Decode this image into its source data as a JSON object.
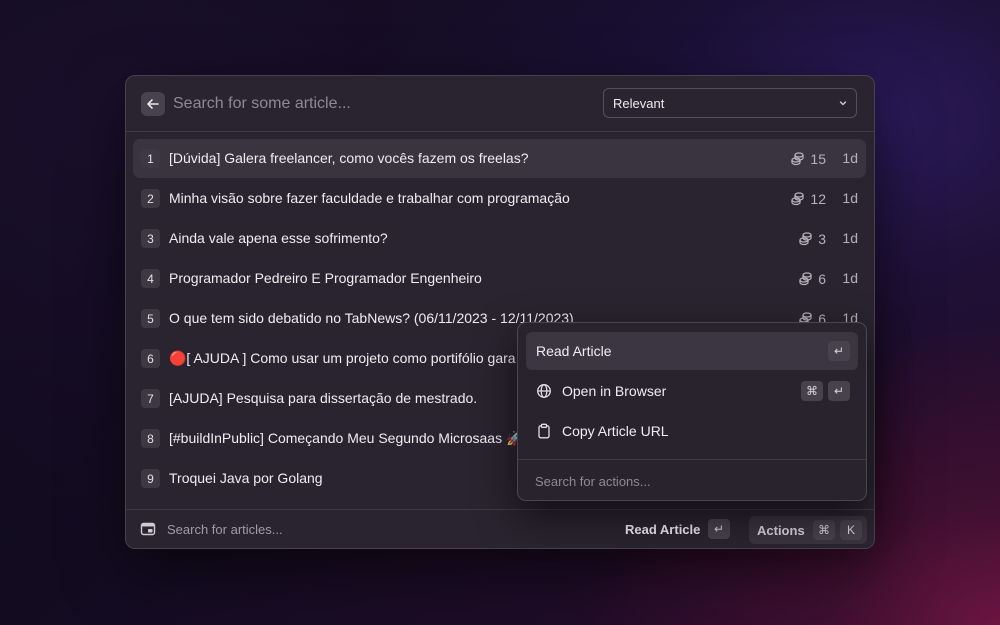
{
  "header": {
    "search_placeholder": "Search for some article...",
    "sort_value": "Relevant"
  },
  "articles": [
    {
      "index": "1",
      "title": "[Dúvida] Galera freelancer, como vocês fazem os freelas?",
      "coins": "15",
      "age": "1d"
    },
    {
      "index": "2",
      "title": "Minha visão sobre fazer faculdade e trabalhar com programação",
      "coins": "12",
      "age": "1d"
    },
    {
      "index": "3",
      "title": "Ainda vale apena esse sofrimento?",
      "coins": "3",
      "age": "1d"
    },
    {
      "index": "4",
      "title": "Programador Pedreiro E Programador Engenheiro",
      "coins": "6",
      "age": "1d"
    },
    {
      "index": "5",
      "title": "O que tem sido debatido no TabNews? (06/11/2023 - 12/11/2023)",
      "coins": "6",
      "age": "1d"
    },
    {
      "index": "6",
      "title": "🔴[ AJUDA ] Como usar um projeto como portifólio gara",
      "coins": "",
      "age": ""
    },
    {
      "index": "7",
      "title": "[AJUDA] Pesquisa para dissertação de mestrado.",
      "coins": "",
      "age": ""
    },
    {
      "index": "8",
      "title": "[#buildInPublic] Começando Meu Segundo Microsaas 🚀",
      "coins": "",
      "age": ""
    },
    {
      "index": "9",
      "title": "Troquei Java por Golang",
      "coins": "",
      "age": ""
    }
  ],
  "footer": {
    "search_text": "Search for articles...",
    "primary_action": "Read Article",
    "enter_key": "↵",
    "actions_label": "Actions",
    "cmd_key": "⌘",
    "k_key": "K"
  },
  "actions_menu": {
    "items": [
      {
        "label": "Read Article",
        "shortcut": [
          "↵"
        ],
        "icon": "none"
      },
      {
        "label": "Open in Browser",
        "shortcut": [
          "⌘",
          "↵"
        ],
        "icon": "globe-icon"
      },
      {
        "label": "Copy Article URL",
        "shortcut": [],
        "icon": "clipboard-icon"
      }
    ],
    "search_placeholder": "Search for actions..."
  },
  "colors": {
    "window_bg": "#2a2430",
    "selected_row": "#3a3440",
    "text_primary": "#efedf2",
    "text_muted": "#b4b0ba"
  }
}
